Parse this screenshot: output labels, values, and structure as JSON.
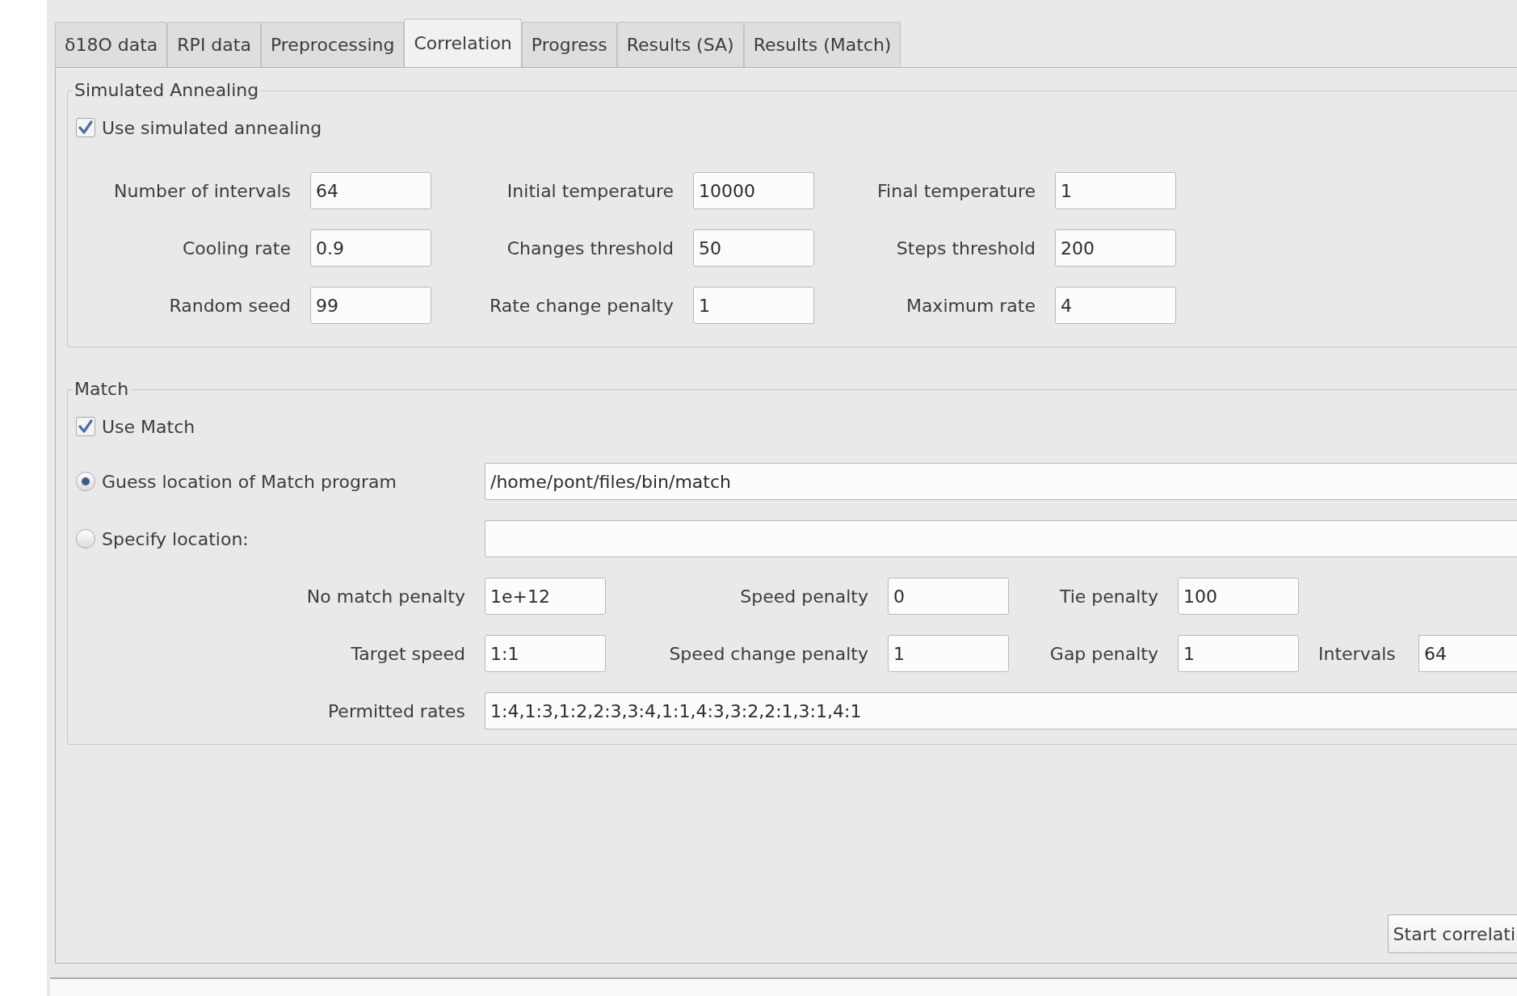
{
  "tabs": [
    {
      "label": "δ18O data",
      "selected": false
    },
    {
      "label": "RPI data",
      "selected": false
    },
    {
      "label": "Preprocessing",
      "selected": false
    },
    {
      "label": "Correlation",
      "selected": true
    },
    {
      "label": "Progress",
      "selected": false
    },
    {
      "label": "Results (SA)",
      "selected": false
    },
    {
      "label": "Results (Match)",
      "selected": false
    }
  ],
  "simulated_annealing": {
    "title": "Simulated Annealing",
    "use_checkbox": {
      "label": "Use simulated annealing",
      "checked": true
    },
    "fields": [
      {
        "label": "Number of intervals",
        "value": "64"
      },
      {
        "label": "Initial temperature",
        "value": "10000"
      },
      {
        "label": "Final temperature",
        "value": "1"
      },
      {
        "label": "Cooling rate",
        "value": "0.9"
      },
      {
        "label": "Changes threshold",
        "value": "50"
      },
      {
        "label": "Steps threshold",
        "value": "200"
      },
      {
        "label": "Random seed",
        "value": "99"
      },
      {
        "label": "Rate change penalty",
        "value": "1"
      },
      {
        "label": "Maximum rate",
        "value": "4"
      }
    ]
  },
  "match": {
    "title": "Match",
    "use_checkbox": {
      "label": "Use Match",
      "checked": true
    },
    "location_options": [
      {
        "label": "Guess location of Match program",
        "selected": true,
        "value": "/home/pont/files/bin/match"
      },
      {
        "label": "Specify location:",
        "selected": false
      }
    ],
    "field_rows": [
      [
        {
          "label": "No match penalty",
          "value": "1e+12"
        },
        {
          "label": "Speed penalty",
          "value": "0"
        },
        {
          "label": "Tie penalty",
          "value": "100"
        }
      ],
      [
        {
          "label": "Target speed",
          "value": "1:1"
        },
        {
          "label": "Speed change penalty",
          "value": "1"
        },
        {
          "label": "Gap penalty",
          "value": "1"
        },
        {
          "label": "Intervals",
          "value": "64"
        }
      ]
    ],
    "permitted_rates": {
      "label": "Permitted rates",
      "value": "1:4,1:3,1:2,2:3,3:4,1:1,4:3,3:2,2:1,3:1,4:1"
    }
  },
  "start_button": "Start correlati"
}
